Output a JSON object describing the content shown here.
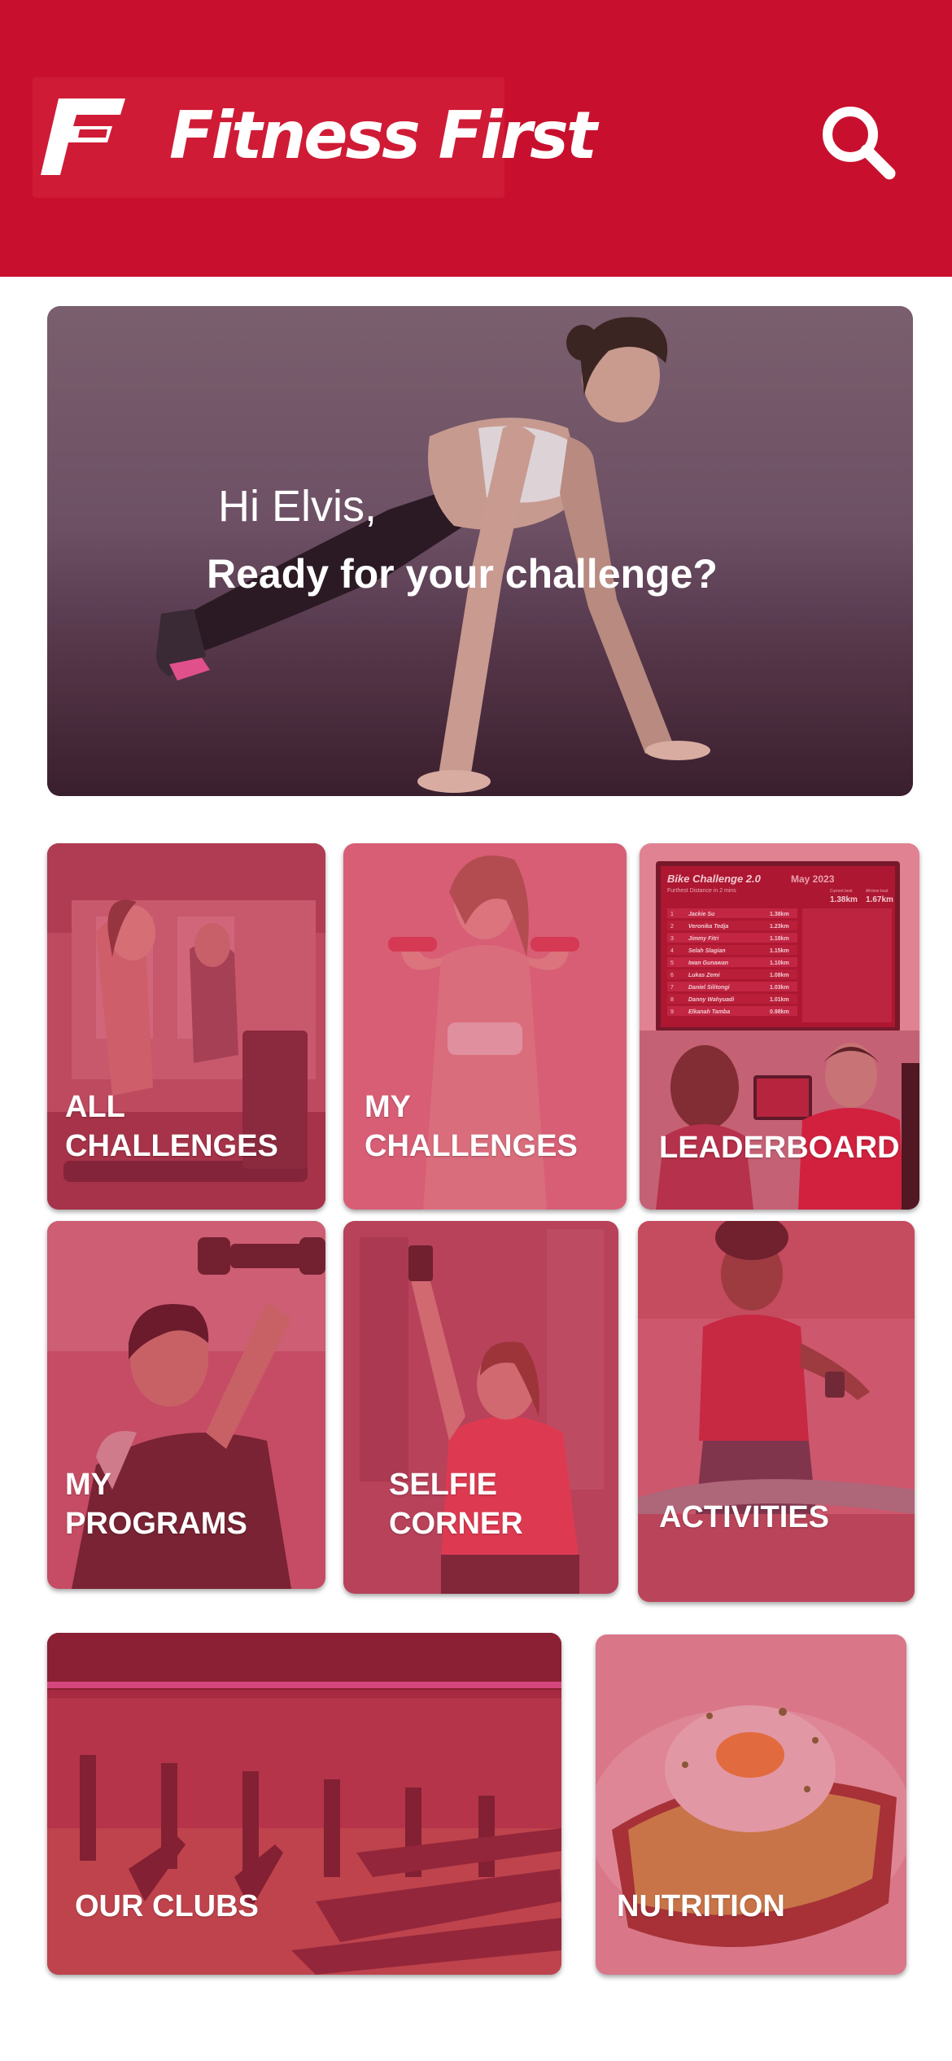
{
  "header": {
    "brand": "Fitness First",
    "logo_icon": "fitness-first-logo-mark",
    "search_icon": "search-icon",
    "background_color": "#c8102e"
  },
  "hero": {
    "greeting": "Hi Elvis,",
    "subtitle": "Ready for your challenge?"
  },
  "tiles": {
    "all_challenges": "ALL\nCHALLENGES",
    "my_challenges": "MY\nCHALLENGES",
    "leaderboard": "LEADERBOARD",
    "my_programs": "MY\nPROGRAMS",
    "selfie_corner": "SELFIE\nCORNER",
    "activities": "ACTIVITIES",
    "our_clubs": "OUR CLUBS",
    "nutrition": "NUTRITION"
  },
  "leaderboard_screen": {
    "title": "Bike Challenge 2.0",
    "subtitle": "Furthest Distance in 2 mins",
    "month": "May 2023",
    "current_best_label": "Current best",
    "all_time_label": "All-time best",
    "current_best": "1.38km",
    "all_time_best": "1.67km",
    "entries": [
      {
        "rank": "1",
        "name": "Jackie Su",
        "value": "1.38km"
      },
      {
        "rank": "2",
        "name": "Veronika Tedja",
        "value": "1.23km"
      },
      {
        "rank": "3",
        "name": "Jimmy Fitri",
        "value": "1.18km"
      },
      {
        "rank": "4",
        "name": "Selah Slagian",
        "value": "1.15km"
      },
      {
        "rank": "5",
        "name": "Iwan Gunawan",
        "value": "1.10km"
      },
      {
        "rank": "6",
        "name": "Lukas Zemi",
        "value": "1.08km"
      },
      {
        "rank": "7",
        "name": "Daniel Silitongi",
        "value": "1.03km"
      },
      {
        "rank": "8",
        "name": "Danny Wahyuadi",
        "value": "1.01km"
      },
      {
        "rank": "9",
        "name": "Elkanah Tamba",
        "value": "0.98km"
      }
    ]
  },
  "colors": {
    "brand_red": "#c8102e",
    "tile_overlay": "#d6455f"
  }
}
